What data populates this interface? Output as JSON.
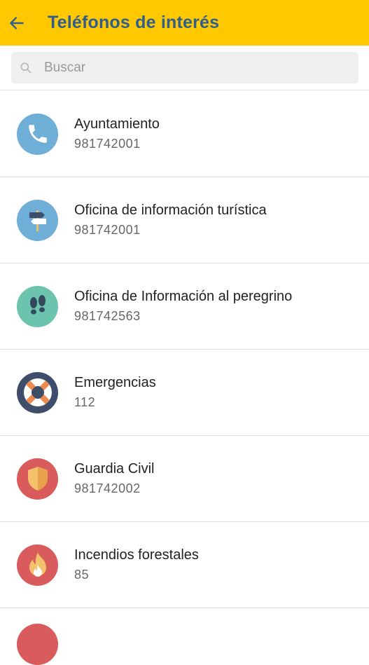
{
  "header": {
    "title": "Teléfonos de interés",
    "background_color": "#FFC800",
    "title_color": "#2F5F8F"
  },
  "search": {
    "placeholder": "Buscar",
    "value": ""
  },
  "contacts": [
    {
      "name": "Ayuntamiento",
      "phone": "981742001",
      "icon": "phone-icon",
      "icon_color": "#6FAED6"
    },
    {
      "name": "Oficina de información turística",
      "phone": "981742001",
      "icon": "signpost-icon",
      "icon_color": "#6FAED6"
    },
    {
      "name": "Oficina de Información al peregrino",
      "phone": "981742563",
      "icon": "footprints-icon",
      "icon_color": "#6CC3AE"
    },
    {
      "name": "Emergencias",
      "phone": "112",
      "icon": "lifebuoy-icon",
      "icon_color": "#3E4E6A"
    },
    {
      "name": "Guardia Civil",
      "phone": "981742002",
      "icon": "shield-icon",
      "icon_color": "#D95B5B"
    },
    {
      "name": "Incendios forestales",
      "phone": "85",
      "icon": "fire-icon",
      "icon_color": "#D95B5B"
    }
  ]
}
